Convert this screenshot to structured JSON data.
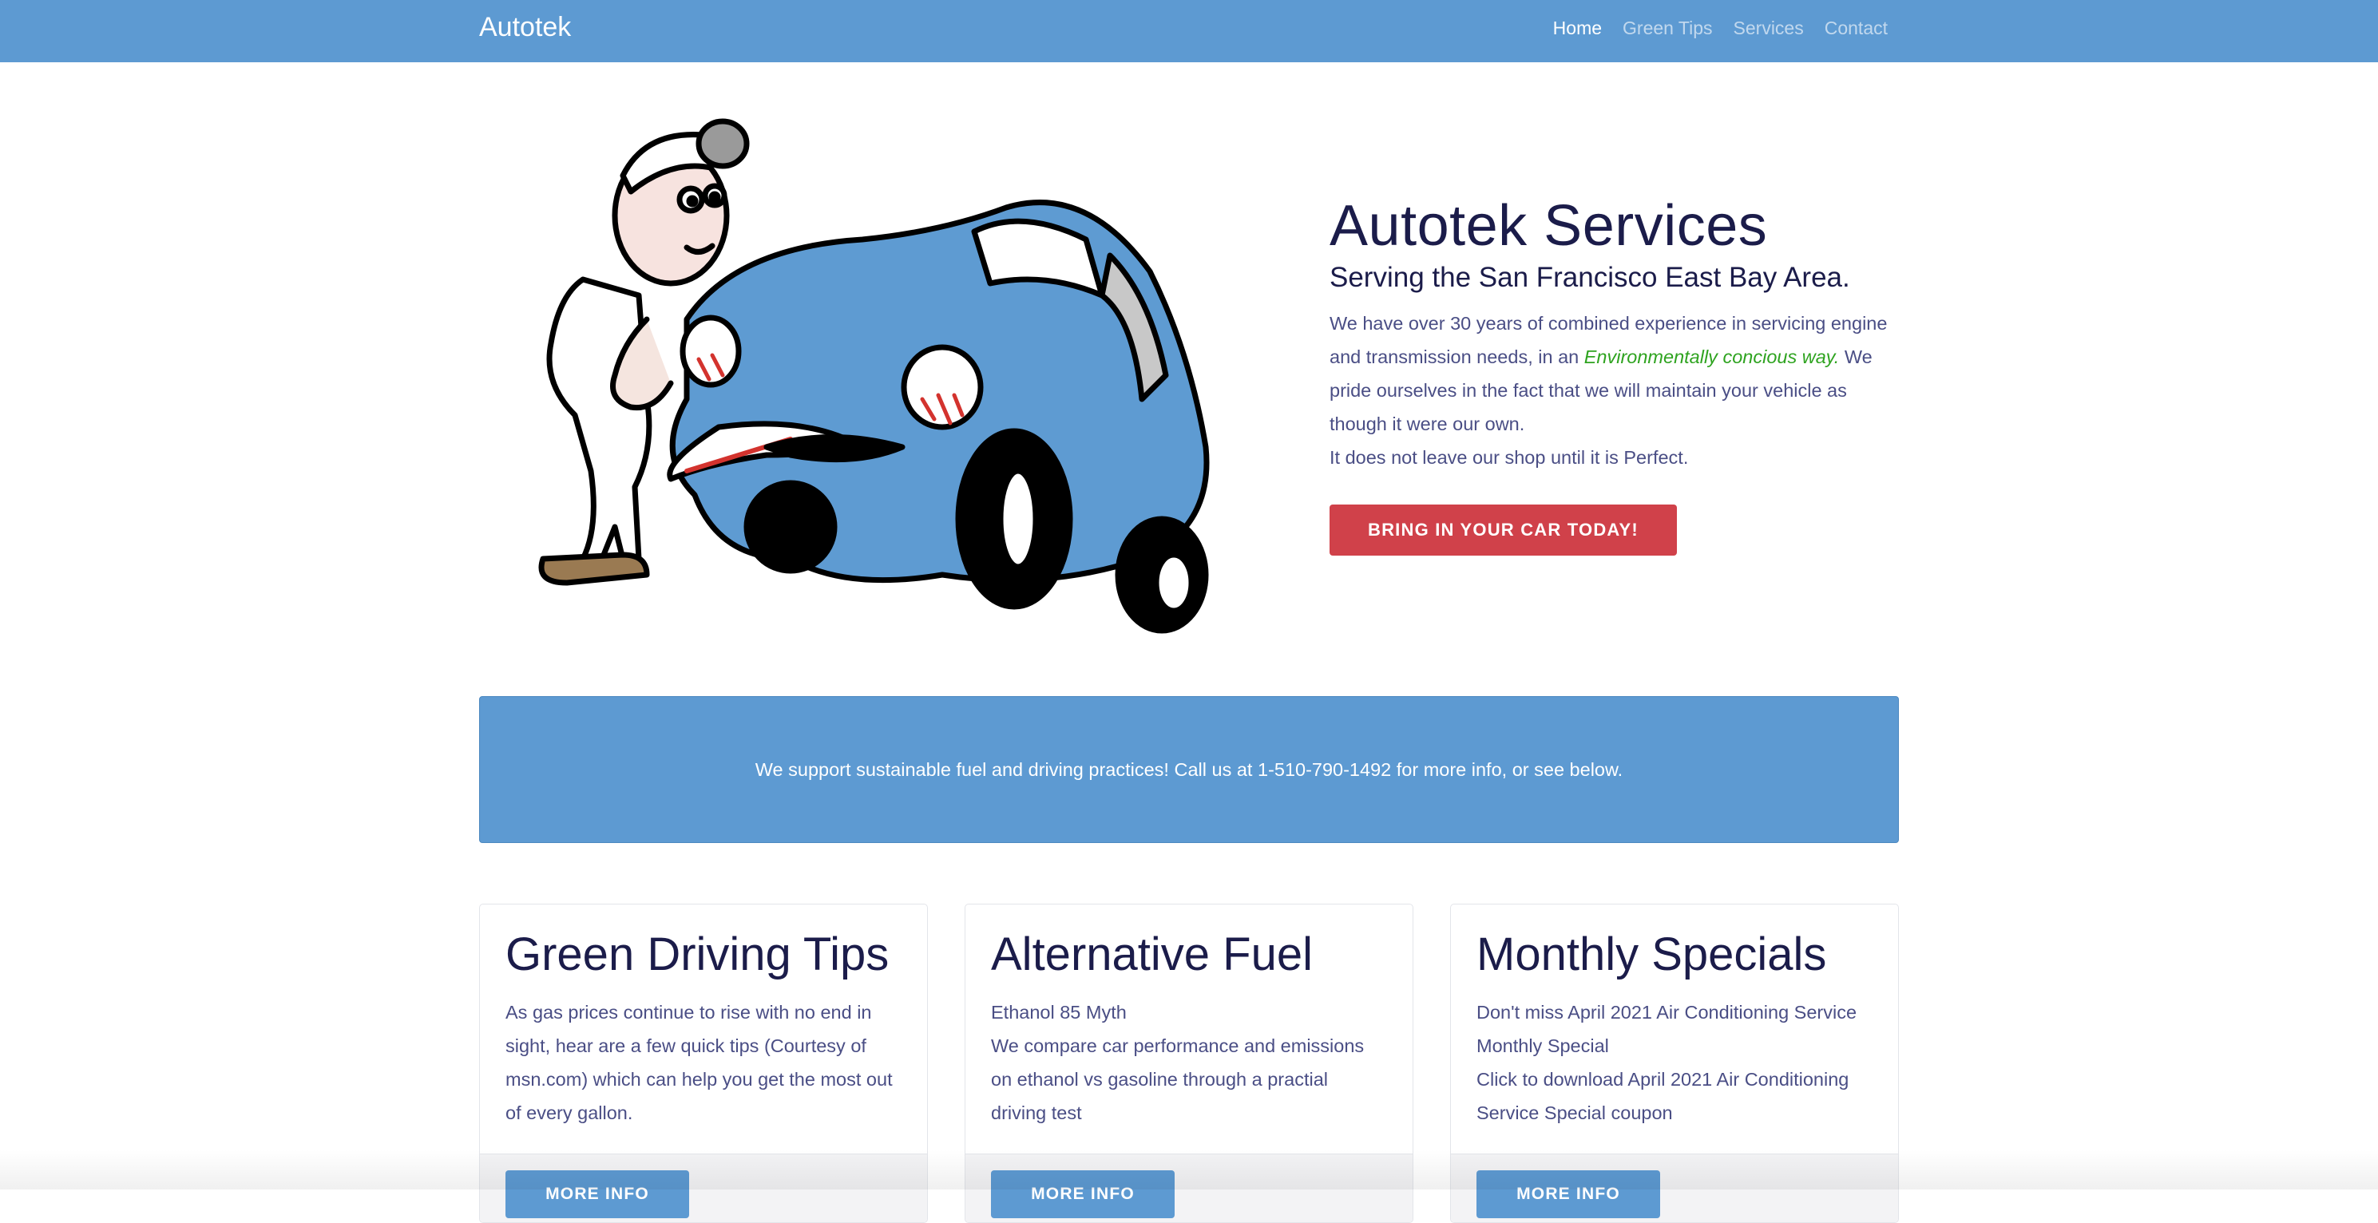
{
  "navbar": {
    "brand": "Autotek",
    "links": [
      {
        "label": "Home",
        "active": true
      },
      {
        "label": "Green Tips",
        "active": false
      },
      {
        "label": "Services",
        "active": false
      },
      {
        "label": "Contact",
        "active": false
      }
    ]
  },
  "hero": {
    "illustration": "mechanic-with-cartoon-car",
    "title": "Autotek Services",
    "subtitle": "Serving the San Francisco East Bay Area.",
    "paragraph_before": "We have over 30 years of combined experience in servicing engine and transmission needs, in an ",
    "paragraph_highlight": "Environmentally concious way.",
    "paragraph_after": " We pride ourselves in the fact that we will maintain your vehicle as though it were our own.",
    "paragraph2": "It does not leave our shop until it is Perfect.",
    "cta_label": "BRING IN YOUR CAR TODAY!"
  },
  "banner": {
    "text": "We support sustainable fuel and driving practices! Call us at 1-510-790-1492 for more info, or see below."
  },
  "cards": [
    {
      "title": "Green Driving Tips",
      "lines": [
        "As gas prices continue to rise with no end in sight, hear are a few quick tips (Courtesy of msn.com) which can help you get the most out of every gallon."
      ],
      "button": "MORE INFO"
    },
    {
      "title": "Alternative Fuel",
      "lines": [
        "Ethanol 85 Myth",
        "We compare car performance and emissions on ethanol vs gasoline through a practial driving test"
      ],
      "button": "MORE INFO"
    },
    {
      "title": "Monthly Specials",
      "lines": [
        "Don't miss April 2021 Air Conditioning Service Monthly Special",
        "Click to download April 2021 Air Conditioning Service Special coupon"
      ],
      "button": "MORE INFO"
    }
  ],
  "colors": {
    "brand_blue": "#5d9ad2",
    "heading_navy": "#1b1c4a",
    "body_text": "#4a4e85",
    "cta_red": "#d0414a",
    "eco_green": "#2ea31f"
  }
}
